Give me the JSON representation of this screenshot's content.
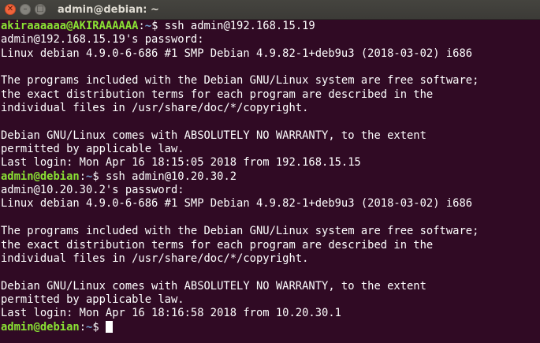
{
  "window": {
    "title": "admin@debian: ~"
  },
  "terminal": {
    "lines": [
      {
        "type": "prompt",
        "user": "akiraaaaaa@AKIRAAAAAA",
        "path": "~",
        "sym": "$ ",
        "cmd": "ssh admin@192.168.15.19"
      },
      {
        "type": "text",
        "text": "admin@192.168.15.19's password:"
      },
      {
        "type": "text",
        "text": "Linux debian 4.9.0-6-686 #1 SMP Debian 4.9.82-1+deb9u3 (2018-03-02) i686"
      },
      {
        "type": "text",
        "text": ""
      },
      {
        "type": "text",
        "text": "The programs included with the Debian GNU/Linux system are free software;"
      },
      {
        "type": "text",
        "text": "the exact distribution terms for each program are described in the"
      },
      {
        "type": "text",
        "text": "individual files in /usr/share/doc/*/copyright."
      },
      {
        "type": "text",
        "text": ""
      },
      {
        "type": "text",
        "text": "Debian GNU/Linux comes with ABSOLUTELY NO WARRANTY, to the extent"
      },
      {
        "type": "text",
        "text": "permitted by applicable law."
      },
      {
        "type": "text",
        "text": "Last login: Mon Apr 16 18:15:05 2018 from 192.168.15.15"
      },
      {
        "type": "prompt",
        "user": "admin@debian",
        "path": "~",
        "sym": "$ ",
        "cmd": "ssh admin@10.20.30.2"
      },
      {
        "type": "text",
        "text": "admin@10.20.30.2's password:"
      },
      {
        "type": "text",
        "text": "Linux debian 4.9.0-6-686 #1 SMP Debian 4.9.82-1+deb9u3 (2018-03-02) i686"
      },
      {
        "type": "text",
        "text": ""
      },
      {
        "type": "text",
        "text": "The programs included with the Debian GNU/Linux system are free software;"
      },
      {
        "type": "text",
        "text": "the exact distribution terms for each program are described in the"
      },
      {
        "type": "text",
        "text": "individual files in /usr/share/doc/*/copyright."
      },
      {
        "type": "text",
        "text": ""
      },
      {
        "type": "text",
        "text": "Debian GNU/Linux comes with ABSOLUTELY NO WARRANTY, to the extent"
      },
      {
        "type": "text",
        "text": "permitted by applicable law."
      },
      {
        "type": "text",
        "text": "Last login: Mon Apr 16 18:16:58 2018 from 10.20.30.1"
      },
      {
        "type": "prompt",
        "user": "admin@debian",
        "path": "~",
        "sym": "$ ",
        "cmd": "",
        "cursor": true
      }
    ]
  },
  "colors": {
    "background": "#300a24",
    "prompt_user": "#8ae234",
    "prompt_path": "#729fcf",
    "text": "#ffffff",
    "close_button": "#f0643c"
  }
}
